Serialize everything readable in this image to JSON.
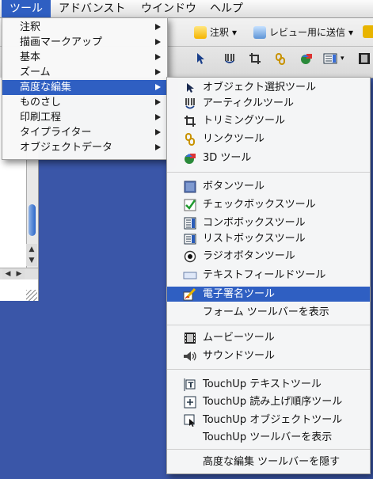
{
  "menubar": {
    "items": [
      "ツール",
      "アドバンスト",
      "ウインドウ",
      "ヘルプ"
    ],
    "active_index": 0
  },
  "toolbar": {
    "row1": [
      "注釈",
      "レビュー用に送信"
    ],
    "row1_dropdown": "▾"
  },
  "tools_menu": {
    "items": [
      {
        "label": "注釈",
        "submenu": true
      },
      {
        "label": "描画マークアップ",
        "submenu": true
      },
      {
        "label": "基本",
        "submenu": true
      },
      {
        "label": "ズーム",
        "submenu": true
      },
      {
        "label": "高度な編集",
        "submenu": true,
        "selected": true
      },
      {
        "label": "ものさし",
        "submenu": true
      },
      {
        "label": "印刷工程",
        "submenu": true
      },
      {
        "label": "タイプライター",
        "submenu": true
      },
      {
        "label": "オブジェクトデータ",
        "submenu": true
      }
    ]
  },
  "advanced_editing_submenu": {
    "groups": [
      [
        {
          "label": "オブジェクト選択ツール",
          "icon": "pointer-icon"
        },
        {
          "label": "アーティクルツール",
          "icon": "article-icon"
        },
        {
          "label": "トリミングツール",
          "icon": "crop-icon"
        },
        {
          "label": "リンクツール",
          "icon": "link-icon"
        },
        {
          "label": "3D ツール",
          "icon": "3d-icon"
        }
      ],
      [
        {
          "label": "ボタンツール",
          "icon": "button-icon"
        },
        {
          "label": "チェックボックスツール",
          "icon": "checkbox-icon"
        },
        {
          "label": "コンボボックスツール",
          "icon": "combobox-icon"
        },
        {
          "label": "リストボックスツール",
          "icon": "listbox-icon"
        },
        {
          "label": "ラジオボタンツール",
          "icon": "radio-icon"
        },
        {
          "label": "テキストフィールドツール",
          "icon": "textfield-icon"
        },
        {
          "label": "電子署名ツール",
          "icon": "signature-icon",
          "selected": true
        },
        {
          "label": "フォーム ツールバーを表示",
          "icon": ""
        }
      ],
      [
        {
          "label": "ムービーツール",
          "icon": "movie-icon"
        },
        {
          "label": "サウンドツール",
          "icon": "sound-icon"
        }
      ],
      [
        {
          "label": "TouchUp テキストツール",
          "icon": "touchup-text-icon"
        },
        {
          "label": "TouchUp 読み上げ順序ツール",
          "icon": "touchup-reading-order-icon"
        },
        {
          "label": "TouchUp オブジェクトツール",
          "icon": "touchup-object-icon"
        },
        {
          "label": "TouchUp  ツールバーを表示",
          "icon": ""
        }
      ],
      [
        {
          "label": "高度な編集 ツールバーを隠す",
          "icon": ""
        }
      ]
    ]
  },
  "colors": {
    "selection": "#2f5fc2",
    "desktop": "#3a56a8"
  }
}
